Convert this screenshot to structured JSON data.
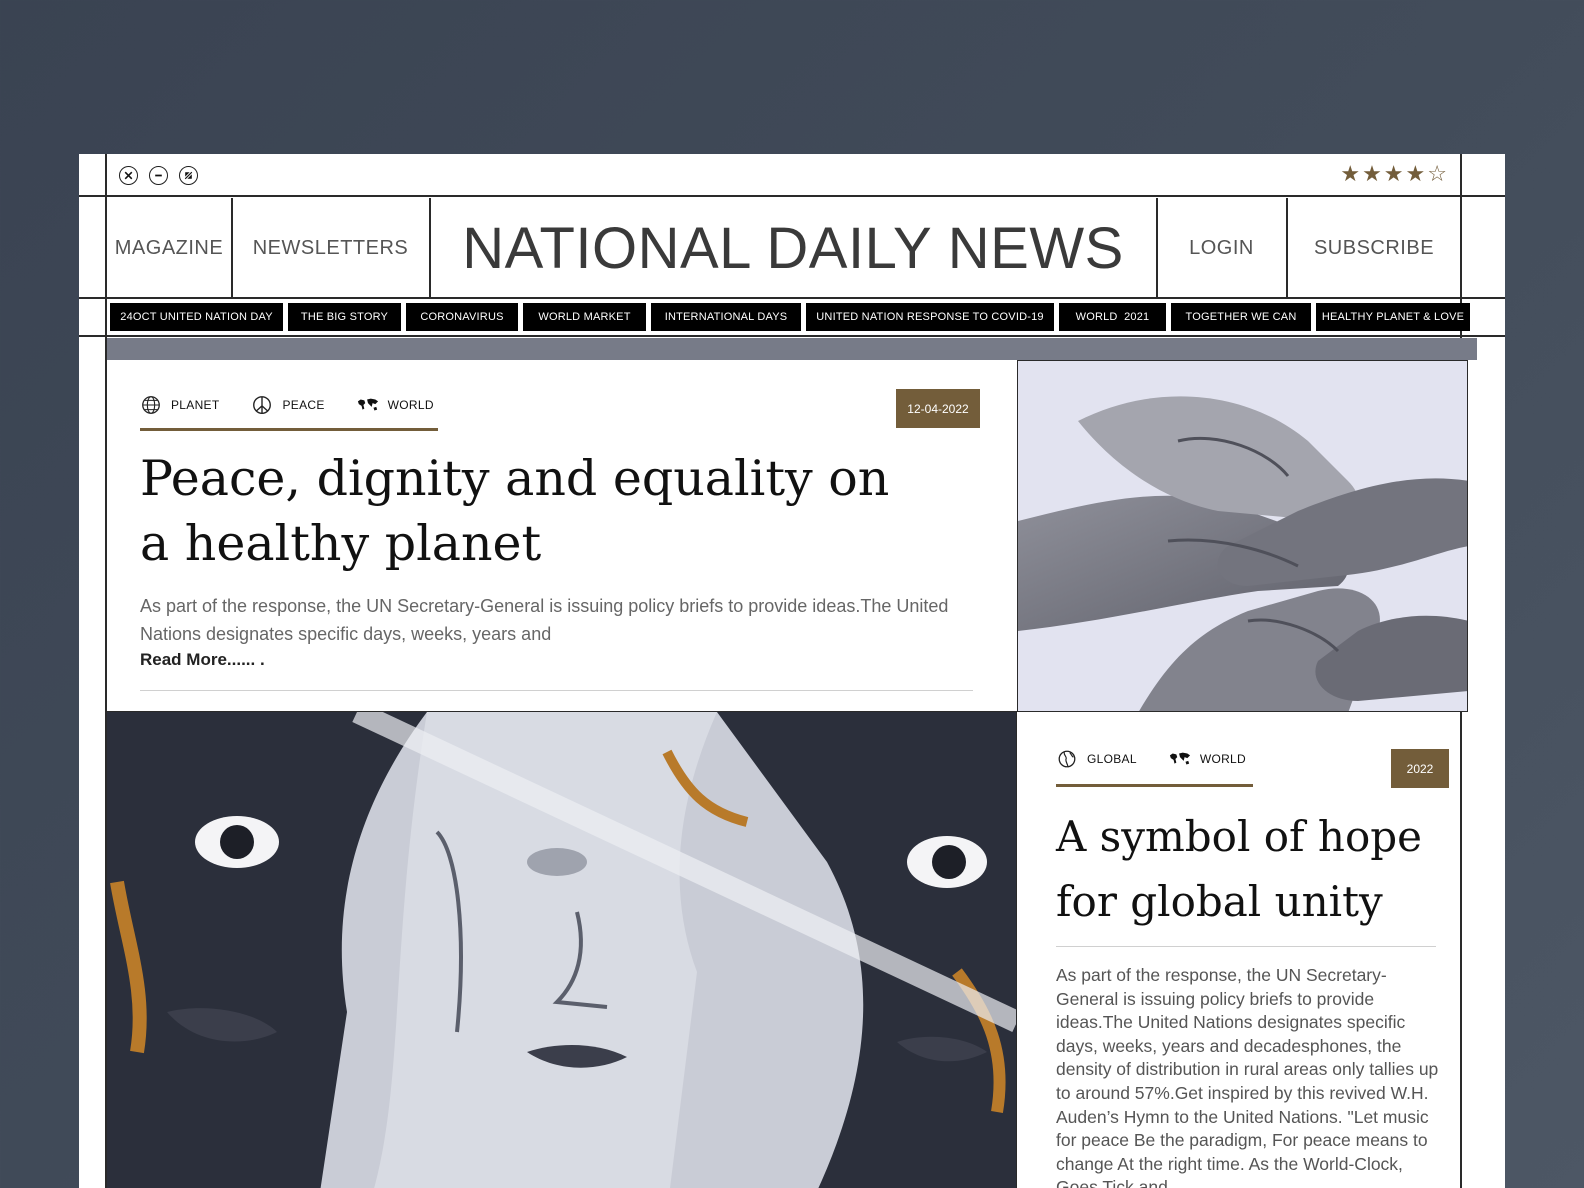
{
  "window": {
    "controls": [
      "close-icon",
      "minimize-icon",
      "expand-icon"
    ],
    "rating": {
      "value": 4,
      "max": 5
    }
  },
  "header": {
    "left_links": [
      "MAGAZINE",
      "NEWSLETTERS"
    ],
    "title": "NATIONAL DAILY NEWS",
    "right_links": [
      "LOGIN",
      "SUBSCRIBE"
    ]
  },
  "tags": [
    "24OCT UNITED NATION DAY",
    "THE BIG STORY",
    "CORONAVIRUS",
    "WORLD MARKET",
    "INTERNATIONAL DAYS",
    "UNITED NATION RESPONSE TO COVID-19",
    "WORLD  2021",
    "TOGETHER WE CAN",
    "HEALTHY PLANET & LOVE"
  ],
  "article1": {
    "categories": [
      {
        "label": "PLANET",
        "icon": "globe-icon"
      },
      {
        "label": "PEACE",
        "icon": "peace-icon"
      },
      {
        "label": "WORLD",
        "icon": "world-map-icon"
      }
    ],
    "date": "12-04-2022",
    "headline": "Peace, dignity and equality on a healthy planet",
    "excerpt": "As part of the response, the UN Secretary-General is issuing policy briefs to provide ideas.The United Nations designates specific days, weeks, years and",
    "read_more": "Read More...... ."
  },
  "article2": {
    "categories": [
      {
        "label": "GLOBAL",
        "icon": "globe-americas-icon"
      },
      {
        "label": "WORLD",
        "icon": "world-map-icon"
      }
    ],
    "date": "2022",
    "headline": "A symbol of hope for global unity",
    "excerpt": "As part of the response, the UN Secretary-General is issuing policy briefs to provide ideas.The United Nations designates specific days, weeks, years and decadesphones, the density of distribution in rural areas only tallies up to around 57%.Get inspired by this revived W.H. Auden’s Hymn to the United Nations. \"Let music for peace Be the paradigm, For peace means to change At the right time. As the World-Clock, Goes Tick and"
  },
  "colors": {
    "accent": "#735d3a",
    "band": "#777b88",
    "tag_bg": "#000000"
  }
}
